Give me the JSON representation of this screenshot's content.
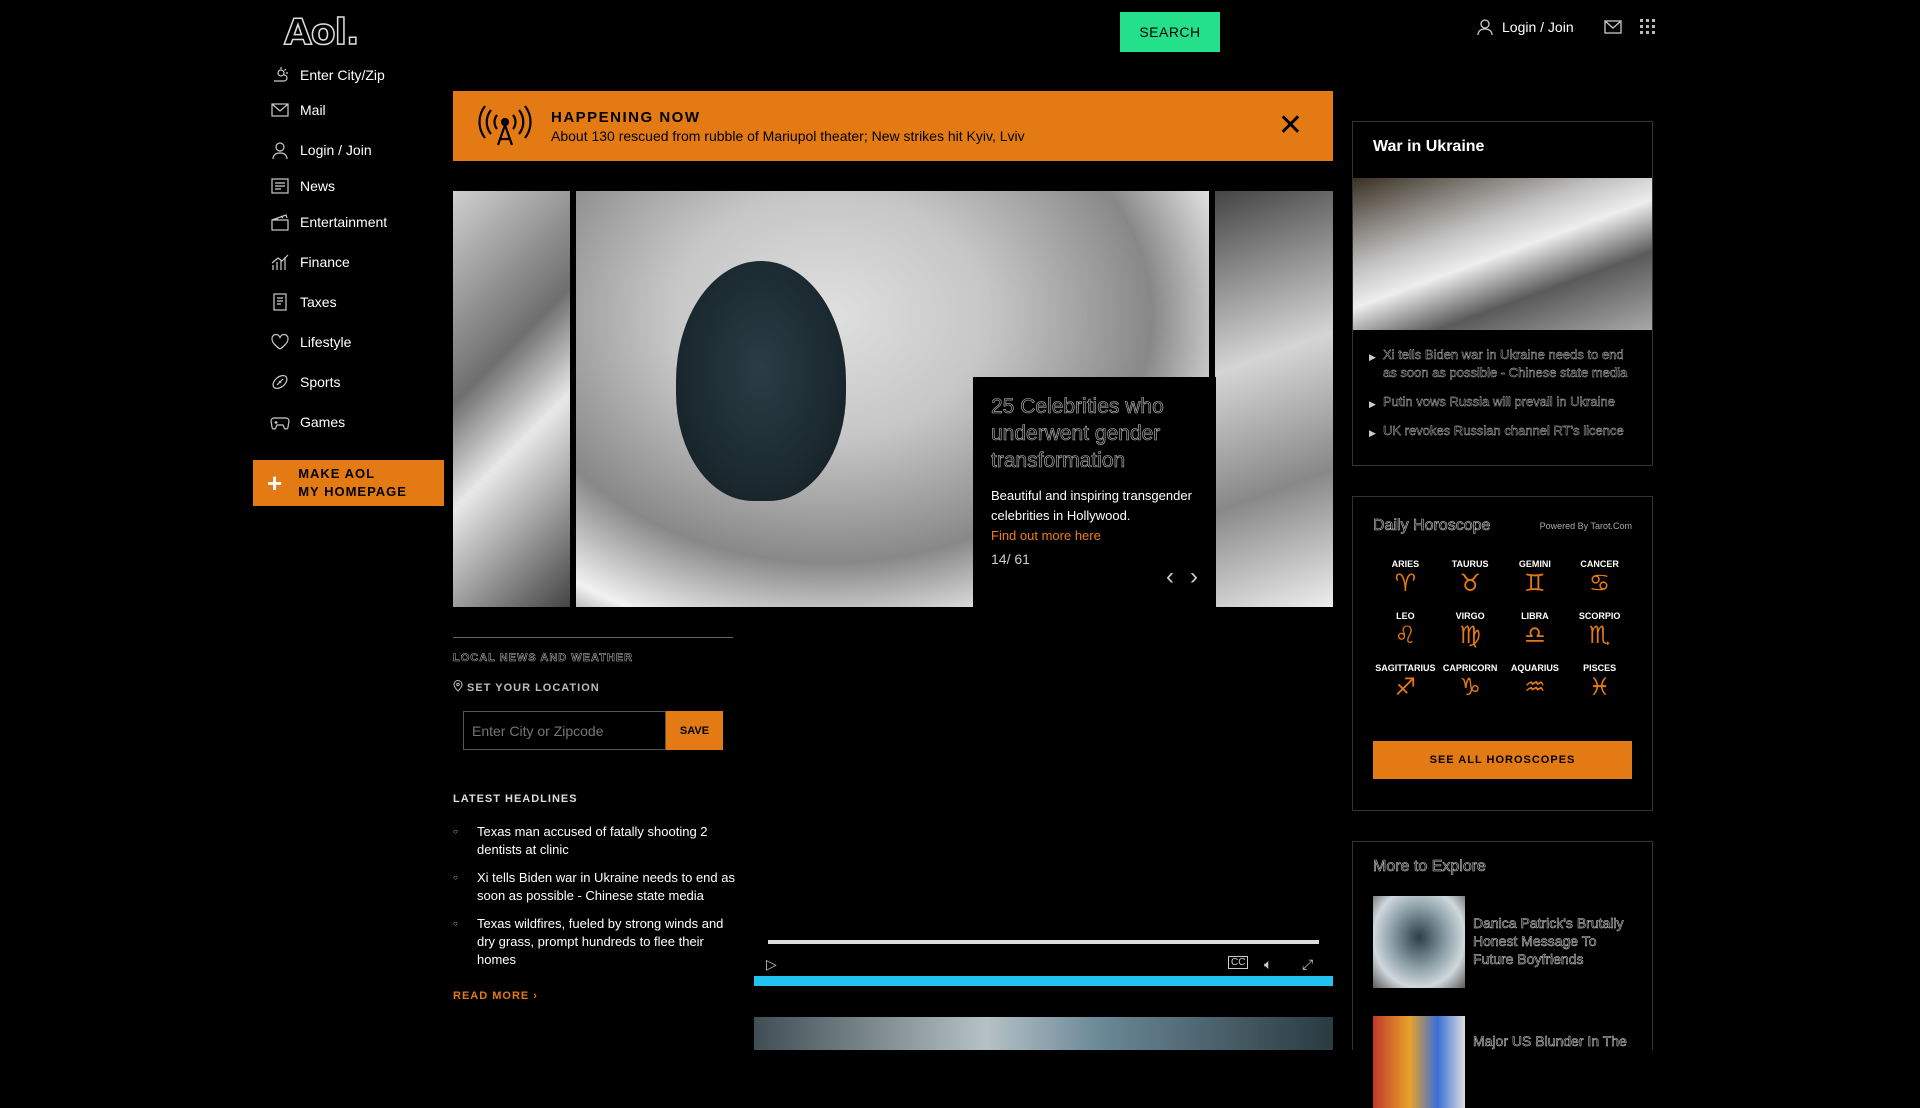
{
  "header": {
    "logo": "Aol.",
    "search_label": "SEARCH",
    "login_label": "Login / Join"
  },
  "sidebar": {
    "items": [
      {
        "label": "Enter City/Zip",
        "icon": "weather-icon"
      },
      {
        "label": "Mail",
        "icon": "mail-icon"
      },
      {
        "label": "Login / Join",
        "icon": "user-icon"
      },
      {
        "label": "News",
        "icon": "news-icon"
      },
      {
        "label": "Entertainment",
        "icon": "clapper-icon"
      },
      {
        "label": "Finance",
        "icon": "finance-icon"
      },
      {
        "label": "Taxes",
        "icon": "taxes-icon"
      },
      {
        "label": "Lifestyle",
        "icon": "heart-icon"
      },
      {
        "label": "Sports",
        "icon": "football-icon"
      },
      {
        "label": "Games",
        "icon": "gamepad-icon"
      }
    ],
    "make_homepage": {
      "line1": "MAKE AOL",
      "line2": "MY HOMEPAGE"
    }
  },
  "banner": {
    "title": "HAPPENING NOW",
    "text": "About 130 rescued from rubble of Mariupol theater; New strikes hit Kyiv, Lviv",
    "icon": "broadcast-icon"
  },
  "carousel": {
    "title": "25 Celebrities who underwent gender transformation",
    "description": "Beautiful and inspiring transgender celebrities in Hollywood.",
    "link": "Find out more here",
    "counter": "14/ 61"
  },
  "local": {
    "heading": "LOCAL NEWS AND WEATHER",
    "set_location": "SET YOUR LOCATION",
    "placeholder": "Enter City or Zipcode",
    "save": "SAVE"
  },
  "latest": {
    "heading": "LATEST HEADLINES",
    "items": [
      "Texas man accused of fatally shooting 2 dentists at clinic",
      "Xi tells Biden war in Ukraine needs to end as soon as possible - Chinese state media",
      "Texas wildfires, fueled by strong winds and dry grass, prompt hundreds to flee their homes"
    ],
    "read_more": "READ MORE ›"
  },
  "video": {
    "cc": "CC"
  },
  "ukraine": {
    "title": "War in Ukraine",
    "items": [
      "Xi tells Biden war in Ukraine needs to end as soon as possible - Chinese state media",
      "Putin vows Russia will prevail in Ukraine",
      "UK revokes Russian channel RT's licence"
    ]
  },
  "horoscope": {
    "title": "Daily Horoscope",
    "powered": "Powered By Tarot.Com",
    "signs": [
      {
        "name": "ARIES",
        "glyph": "♈"
      },
      {
        "name": "TAURUS",
        "glyph": "♉"
      },
      {
        "name": "GEMINI",
        "glyph": "♊"
      },
      {
        "name": "CANCER",
        "glyph": "♋"
      },
      {
        "name": "LEO",
        "glyph": "♌"
      },
      {
        "name": "VIRGO",
        "glyph": "♍"
      },
      {
        "name": "LIBRA",
        "glyph": "♎"
      },
      {
        "name": "SCORPIO",
        "glyph": "♏"
      },
      {
        "name": "SAGITTARIUS",
        "glyph": "♐"
      },
      {
        "name": "CAPRICORN",
        "glyph": "♑"
      },
      {
        "name": "AQUARIUS",
        "glyph": "♒"
      },
      {
        "name": "PISCES",
        "glyph": "♓"
      }
    ],
    "button": "SEE ALL HOROSCOPES"
  },
  "explore": {
    "title": "More to Explore",
    "items": [
      "Danica Patrick's Brutally Honest Message To Future Boyfriends",
      "Major US Blunder In The"
    ]
  },
  "colors": {
    "accent": "#e37a13",
    "search": "#24e08a",
    "video_bar": "#22c3ef"
  }
}
